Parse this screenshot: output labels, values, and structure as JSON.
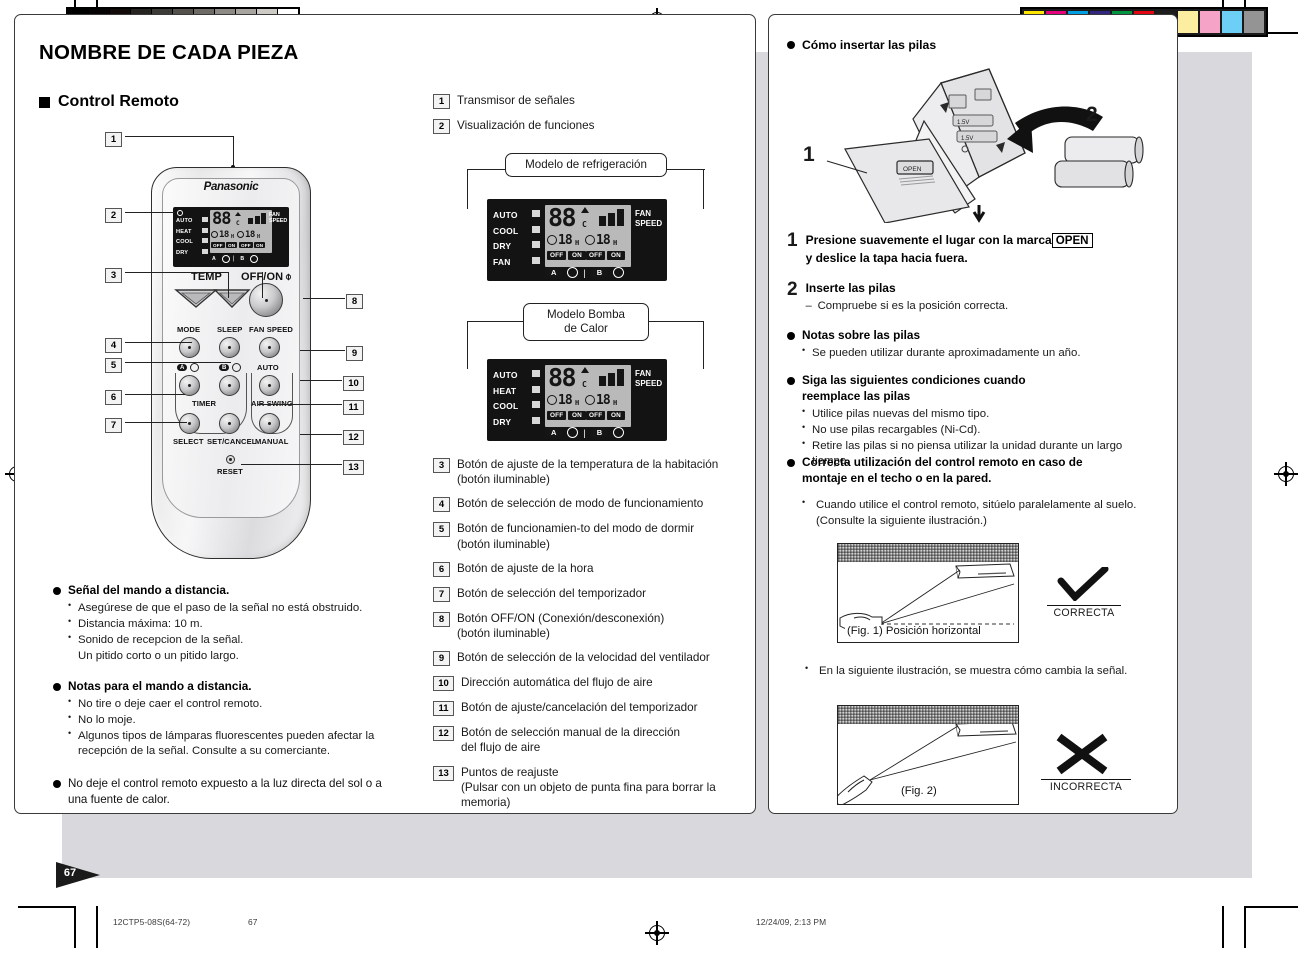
{
  "page": {
    "number_tab": "67",
    "title": "NOMBRE DE CADA PIEZA",
    "section_heading": "Control Remoto"
  },
  "footer": {
    "doc_code": "12CTP5-08S(64-72)",
    "page_number": "67",
    "timestamp": "12/24/09, 2:13 PM"
  },
  "calibration": {
    "gray_swatches": [
      "#000000",
      "#050303",
      "#120b0a",
      "#262421",
      "#3d3b38",
      "#54514c",
      "#6e6a65",
      "#8d8a85",
      "#a8a5a0",
      "#cecbc7",
      "#ffffff"
    ],
    "color_swatches": [
      "#ffe600",
      "#e6007e",
      "#009fe3",
      "#312783",
      "#009640",
      "#e30613",
      "#1d1d1b",
      "#fbeea0",
      "#f5a3c7",
      "#6ecff6",
      "#949494"
    ]
  },
  "remote": {
    "brand": "Panasonic",
    "lcd": {
      "modes": [
        "AUTO",
        "HEAT",
        "COOL",
        "DRY"
      ],
      "temp_digits": "88",
      "temp_unit": "C",
      "timer_a_value": "18",
      "timer_a_unit": "H",
      "timer_b_value": "18",
      "timer_b_unit": "H",
      "off_label": "OFF",
      "on_label": "ON",
      "fan_speed_label_line1": "FAN",
      "fan_speed_label_line2": "SPEED",
      "tag_a": "A",
      "tag_b": "B"
    },
    "labels": {
      "temp": "TEMP",
      "off_on": "OFF/ON",
      "mode": "MODE",
      "sleep": "SLEEP",
      "fan_speed": "FAN SPEED",
      "auto": "AUTO",
      "timer": "TIMER",
      "air_swing": "AIR SWING",
      "select": "SELECT",
      "set_cancel": "SET/CANCEL",
      "manual": "MANUAL",
      "reset": "RESET",
      "tag_a": "A",
      "tag_b": "B"
    },
    "callouts": [
      "1",
      "2",
      "3",
      "4",
      "5",
      "6",
      "7",
      "8",
      "9",
      "10",
      "11",
      "12",
      "13"
    ]
  },
  "parts_list": [
    {
      "num": "1",
      "text": "Transmisor de señales"
    },
    {
      "num": "2",
      "text": "Visualización de funciones"
    },
    {
      "num": "3",
      "text": "Botón de ajuste de la temperatura de la habitación\n(botón iluminable)"
    },
    {
      "num": "4",
      "text": "Botón de selección de modo de funcionamiento"
    },
    {
      "num": "5",
      "text": "Botón de funcionamien-to del modo de dormir\n(botón iluminable)"
    },
    {
      "num": "6",
      "text": "Botón de ajuste de la hora"
    },
    {
      "num": "7",
      "text": "Botón de selección del temporizador"
    },
    {
      "num": "8",
      "text": "Botón OFF/ON (Conexión/desconexión)\n(botón iluminable)"
    },
    {
      "num": "9",
      "text": "Botón de selección de la velocidad del ventilador"
    },
    {
      "num": "10",
      "text": "Dirección automática del flujo de aire"
    },
    {
      "num": "11",
      "text": "Botón de ajuste/cancelación del temporizador"
    },
    {
      "num": "12",
      "text": "Botón de selección manual de la dirección\ndel flujo de aire"
    },
    {
      "num": "13",
      "text": "Puntos de reajuste\n(Pulsar con un objeto de punta fina para borrar la\nmemoria)"
    }
  ],
  "display_panels": {
    "cooling": {
      "caption": "Modelo de refrigeración",
      "modes": [
        "AUTO",
        "COOL",
        "DRY",
        "FAN"
      ],
      "temp_digits": "88",
      "temp_unit": "C",
      "timer_a": "18",
      "timer_b": "18",
      "unit_h": "H",
      "off_label": "OFF",
      "on_label": "ON",
      "fan_label_1": "FAN",
      "fan_label_2": "SPEED",
      "tag_a": "A",
      "tag_b": "B"
    },
    "heatpump": {
      "caption_line1": "Modelo Bomba",
      "caption_line2": "de Calor",
      "modes": [
        "AUTO",
        "HEAT",
        "COOL",
        "DRY"
      ],
      "temp_digits": "88",
      "temp_unit": "C",
      "timer_a": "18",
      "timer_b": "18",
      "unit_h": "H",
      "off_label": "OFF",
      "on_label": "ON",
      "fan_label_1": "FAN",
      "fan_label_2": "SPEED",
      "tag_a": "A",
      "tag_b": "B"
    }
  },
  "left_notes": [
    {
      "heading": "Señal del mando a distancia.",
      "bullets": [
        "Asegúrese de que el paso de la señal no está obstruido.",
        "Distancia máxima: 10 m.",
        "Sonido de recepcion de la señal.",
        "Un pitido corto o un pitido largo."
      ],
      "bullet_styles": [
        "dot",
        "dot",
        "dot",
        "none"
      ]
    },
    {
      "heading": "Notas para el mando a distancia.",
      "bullets": [
        "No tire o deje caer el control remoto.",
        "No lo moje.",
        "Algunos tipos de lámparas fluorescentes pueden afectar la recepción de la señal. Consulte a su comerciante."
      ],
      "bullet_styles": [
        "dot",
        "dot",
        "dot"
      ]
    },
    {
      "heading": "",
      "plain": "No deje el control remoto expuesto a la luz directa del sol o a una fuente de calor.",
      "bullets": [],
      "bullet_styles": []
    }
  ],
  "right_column": {
    "battery_heading": "Cómo insertar las pilas",
    "diagram_labels": {
      "one": "1",
      "two": "2",
      "open": "OPEN"
    },
    "step1": {
      "num": "1",
      "text_before": "Presione suavemente el lugar con la marca",
      "boxed": "OPEN",
      "text_after": "y deslice la tapa hacia fuera."
    },
    "step2": {
      "num": "2",
      "heading": "Inserte las pilas",
      "dash_line": "Compruebe si es la posición correcta."
    },
    "notes_batteries": {
      "heading": "Notas sobre las pilas",
      "bullets": [
        "Se pueden utilizar durante aproximadamente un año."
      ]
    },
    "replace_conditions": {
      "heading_line1": "Siga las siguientes condiciones cuando",
      "heading_line2": "reemplace las pilas",
      "bullets": [
        "Utilice pilas nuevas del mismo tipo.",
        "No use pilas recargables (Ni-Cd).",
        "Retire las pilas si no piensa utilizar la unidad durante un largo tiempo."
      ]
    },
    "correct_use": {
      "heading_line1": "Correcta utilización del control remoto en caso de",
      "heading_line2": "montaje en el techo o en la pared.",
      "bullet": "Cuando utilice el control remoto, sitúelo paralelamente al suelo. (Consulte la siguiente ilustración.)"
    },
    "fig1": {
      "caption": "(Fig. 1)  Posición horizontal",
      "mark_label": "CORRECTA"
    },
    "middle_note": "En la siguiente ilustración, se muestra cómo cambia la señal.",
    "fig2": {
      "caption": "(Fig. 2)",
      "mark_label": "INCORRECTA"
    }
  }
}
